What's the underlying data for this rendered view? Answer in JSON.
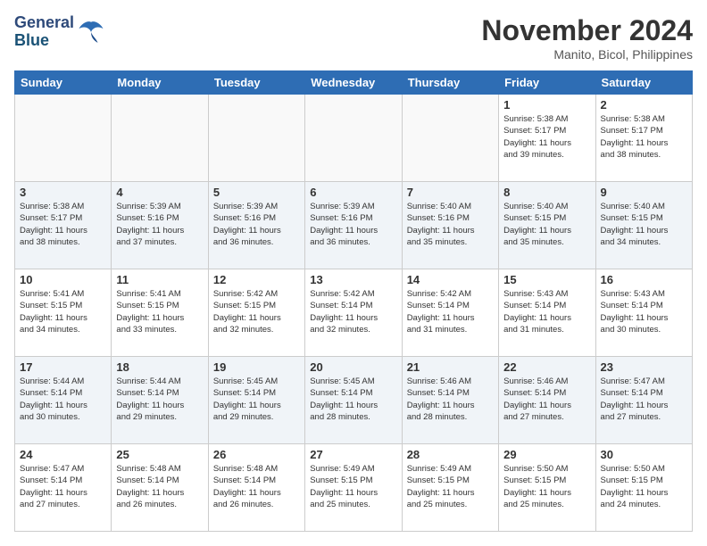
{
  "header": {
    "logo_line1": "General",
    "logo_line2": "Blue",
    "month_title": "November 2024",
    "location": "Manito, Bicol, Philippines"
  },
  "weekdays": [
    "Sunday",
    "Monday",
    "Tuesday",
    "Wednesday",
    "Thursday",
    "Friday",
    "Saturday"
  ],
  "weeks": [
    [
      {
        "day": "",
        "info": ""
      },
      {
        "day": "",
        "info": ""
      },
      {
        "day": "",
        "info": ""
      },
      {
        "day": "",
        "info": ""
      },
      {
        "day": "",
        "info": ""
      },
      {
        "day": "1",
        "info": "Sunrise: 5:38 AM\nSunset: 5:17 PM\nDaylight: 11 hours\nand 39 minutes."
      },
      {
        "day": "2",
        "info": "Sunrise: 5:38 AM\nSunset: 5:17 PM\nDaylight: 11 hours\nand 38 minutes."
      }
    ],
    [
      {
        "day": "3",
        "info": "Sunrise: 5:38 AM\nSunset: 5:17 PM\nDaylight: 11 hours\nand 38 minutes."
      },
      {
        "day": "4",
        "info": "Sunrise: 5:39 AM\nSunset: 5:16 PM\nDaylight: 11 hours\nand 37 minutes."
      },
      {
        "day": "5",
        "info": "Sunrise: 5:39 AM\nSunset: 5:16 PM\nDaylight: 11 hours\nand 36 minutes."
      },
      {
        "day": "6",
        "info": "Sunrise: 5:39 AM\nSunset: 5:16 PM\nDaylight: 11 hours\nand 36 minutes."
      },
      {
        "day": "7",
        "info": "Sunrise: 5:40 AM\nSunset: 5:16 PM\nDaylight: 11 hours\nand 35 minutes."
      },
      {
        "day": "8",
        "info": "Sunrise: 5:40 AM\nSunset: 5:15 PM\nDaylight: 11 hours\nand 35 minutes."
      },
      {
        "day": "9",
        "info": "Sunrise: 5:40 AM\nSunset: 5:15 PM\nDaylight: 11 hours\nand 34 minutes."
      }
    ],
    [
      {
        "day": "10",
        "info": "Sunrise: 5:41 AM\nSunset: 5:15 PM\nDaylight: 11 hours\nand 34 minutes."
      },
      {
        "day": "11",
        "info": "Sunrise: 5:41 AM\nSunset: 5:15 PM\nDaylight: 11 hours\nand 33 minutes."
      },
      {
        "day": "12",
        "info": "Sunrise: 5:42 AM\nSunset: 5:15 PM\nDaylight: 11 hours\nand 32 minutes."
      },
      {
        "day": "13",
        "info": "Sunrise: 5:42 AM\nSunset: 5:14 PM\nDaylight: 11 hours\nand 32 minutes."
      },
      {
        "day": "14",
        "info": "Sunrise: 5:42 AM\nSunset: 5:14 PM\nDaylight: 11 hours\nand 31 minutes."
      },
      {
        "day": "15",
        "info": "Sunrise: 5:43 AM\nSunset: 5:14 PM\nDaylight: 11 hours\nand 31 minutes."
      },
      {
        "day": "16",
        "info": "Sunrise: 5:43 AM\nSunset: 5:14 PM\nDaylight: 11 hours\nand 30 minutes."
      }
    ],
    [
      {
        "day": "17",
        "info": "Sunrise: 5:44 AM\nSunset: 5:14 PM\nDaylight: 11 hours\nand 30 minutes."
      },
      {
        "day": "18",
        "info": "Sunrise: 5:44 AM\nSunset: 5:14 PM\nDaylight: 11 hours\nand 29 minutes."
      },
      {
        "day": "19",
        "info": "Sunrise: 5:45 AM\nSunset: 5:14 PM\nDaylight: 11 hours\nand 29 minutes."
      },
      {
        "day": "20",
        "info": "Sunrise: 5:45 AM\nSunset: 5:14 PM\nDaylight: 11 hours\nand 28 minutes."
      },
      {
        "day": "21",
        "info": "Sunrise: 5:46 AM\nSunset: 5:14 PM\nDaylight: 11 hours\nand 28 minutes."
      },
      {
        "day": "22",
        "info": "Sunrise: 5:46 AM\nSunset: 5:14 PM\nDaylight: 11 hours\nand 27 minutes."
      },
      {
        "day": "23",
        "info": "Sunrise: 5:47 AM\nSunset: 5:14 PM\nDaylight: 11 hours\nand 27 minutes."
      }
    ],
    [
      {
        "day": "24",
        "info": "Sunrise: 5:47 AM\nSunset: 5:14 PM\nDaylight: 11 hours\nand 27 minutes."
      },
      {
        "day": "25",
        "info": "Sunrise: 5:48 AM\nSunset: 5:14 PM\nDaylight: 11 hours\nand 26 minutes."
      },
      {
        "day": "26",
        "info": "Sunrise: 5:48 AM\nSunset: 5:14 PM\nDaylight: 11 hours\nand 26 minutes."
      },
      {
        "day": "27",
        "info": "Sunrise: 5:49 AM\nSunset: 5:15 PM\nDaylight: 11 hours\nand 25 minutes."
      },
      {
        "day": "28",
        "info": "Sunrise: 5:49 AM\nSunset: 5:15 PM\nDaylight: 11 hours\nand 25 minutes."
      },
      {
        "day": "29",
        "info": "Sunrise: 5:50 AM\nSunset: 5:15 PM\nDaylight: 11 hours\nand 25 minutes."
      },
      {
        "day": "30",
        "info": "Sunrise: 5:50 AM\nSunset: 5:15 PM\nDaylight: 11 hours\nand 24 minutes."
      }
    ]
  ]
}
